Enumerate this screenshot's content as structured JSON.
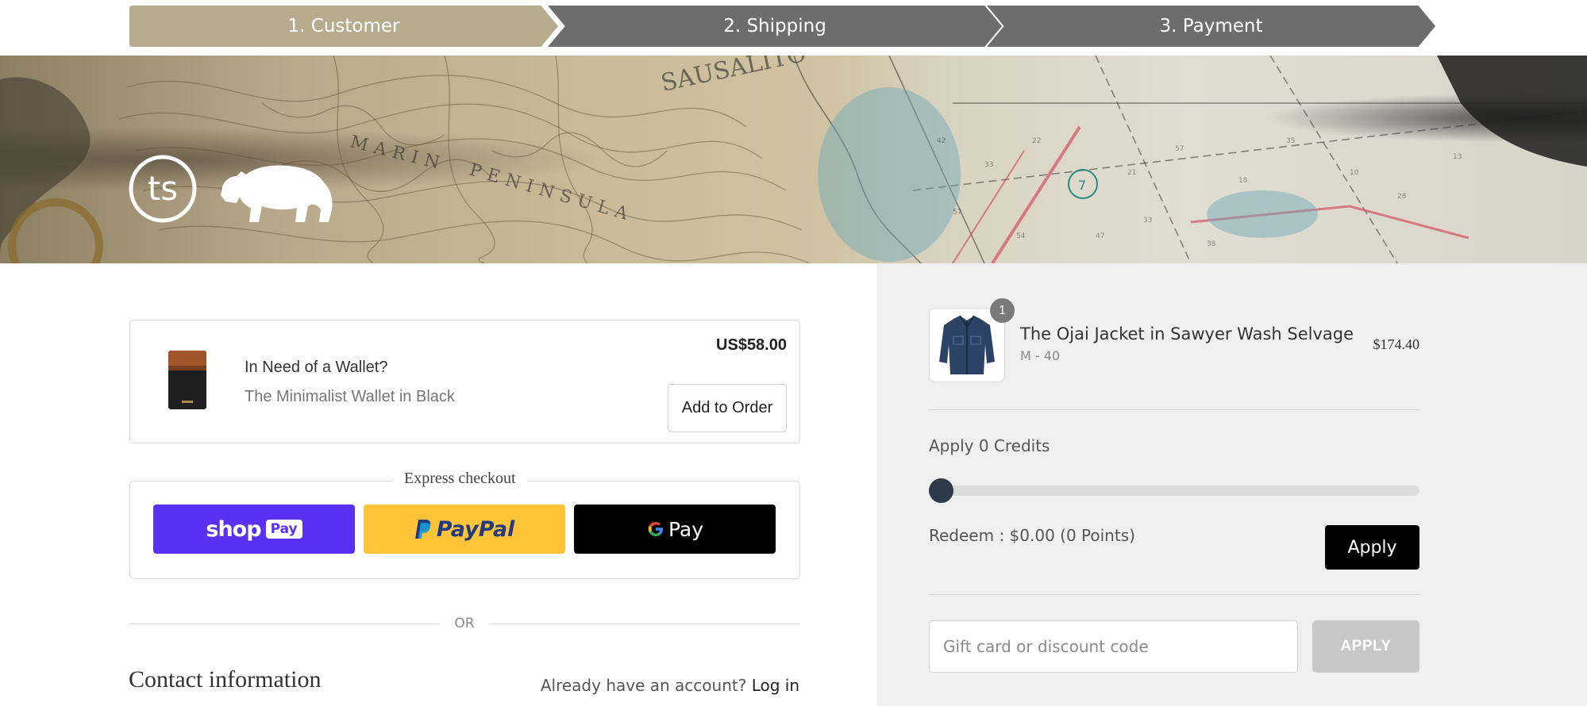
{
  "steps": [
    {
      "label": "1. Customer",
      "state": "active"
    },
    {
      "label": "2. Shipping",
      "state": "inactive"
    },
    {
      "label": "3. Payment",
      "state": "inactive"
    }
  ],
  "banner": {
    "logo_text": "ts",
    "map_words": [
      "SAUSALITO",
      "MARIN",
      "PENINSULA"
    ]
  },
  "upsell": {
    "title": "In Need of a Wallet?",
    "product": "The Minimalist Wallet in Black",
    "price": "US$58.00",
    "button": "Add to Order"
  },
  "express": {
    "title": "Express checkout",
    "shop_pay": "shop",
    "shop_pay_badge": "Pay",
    "paypal": "PayPal",
    "gpay": "Pay"
  },
  "divider_or": "OR",
  "contact": {
    "title": "Contact information",
    "prompt": "Already have an account?",
    "login": "Log in"
  },
  "cart": {
    "item": {
      "title": "The Ojai Jacket in Sawyer Wash Selvage",
      "variant": "M - 40",
      "price": "$174.40",
      "quantity": "1"
    },
    "credits_label": "Apply 0 Credits",
    "credits_slider_value": 0,
    "redeem_label": "Redeem : $0.00 (0 Points)",
    "apply_label": "Apply",
    "gift": {
      "placeholder": "Gift card or discount code",
      "value": "",
      "button": "APPLY"
    }
  },
  "colors": {
    "step_active": "#b7ab8e",
    "step_inactive": "#6d6d6d",
    "sidebar_bg": "#f0f0f0",
    "shop_pay": "#5a31f4",
    "paypal": "#ffc439",
    "gpay": "#000000",
    "slider_thumb": "#2e3a48"
  }
}
